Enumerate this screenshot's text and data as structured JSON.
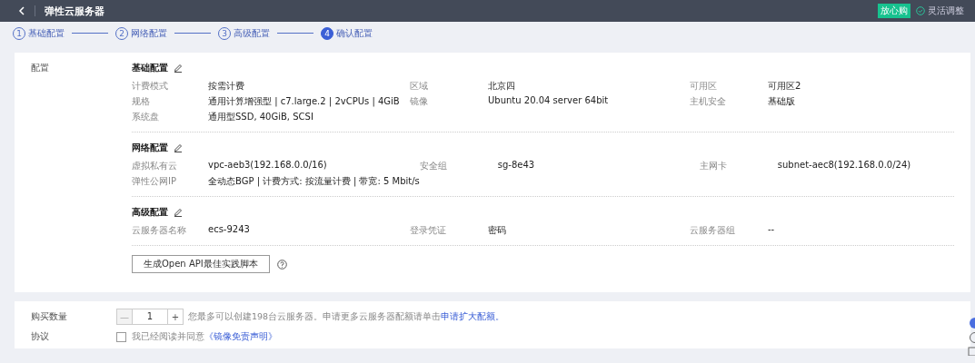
{
  "header": {
    "title": "弹性云服务器",
    "badge": "放心购",
    "adjust": "灵活调整"
  },
  "steps": [
    {
      "number": "1",
      "label": "基础配置",
      "selected": false
    },
    {
      "number": "2",
      "label": "网络配置",
      "selected": false
    },
    {
      "number": "3",
      "label": "高级配置",
      "selected": false
    },
    {
      "number": "4",
      "label": "确认配置",
      "selected": true
    }
  ],
  "config": {
    "label": "配置",
    "sections": [
      {
        "title": "基础配置",
        "fields": [
          {
            "label": "计费模式",
            "value": "按需计费"
          },
          {
            "label": "区域",
            "value": "北京四"
          },
          {
            "label": "可用区",
            "value": "可用区2"
          },
          {
            "label": "规格",
            "value": "通用计算增强型 | c7.large.2 | 2vCPUs | 4GiB"
          },
          {
            "label": "镜像",
            "value": "Ubuntu 20.04 server 64bit"
          },
          {
            "label": "主机安全",
            "value": "基础版"
          },
          {
            "label": "系统盘",
            "value": "通用型SSD, 40GiB, SCSI"
          }
        ]
      },
      {
        "title": "网络配置",
        "fields": [
          {
            "label": "虚拟私有云",
            "value": "vpc-aeb3(192.168.0.0/16)"
          },
          {
            "label": "安全组",
            "value": "sg-8e43"
          },
          {
            "label": "主网卡",
            "value": "subnet-aec8(192.168.0.0/24)"
          },
          {
            "label": "弹性公网IP",
            "value": "全动态BGP | 计费方式: 按流量计费 | 带宽: 5 Mbit/s"
          }
        ]
      },
      {
        "title": "高级配置",
        "fields": [
          {
            "label": "云服务器名称",
            "value": "ecs-9243"
          },
          {
            "label": "登录凭证",
            "value": "密码"
          },
          {
            "label": "云服务器组",
            "value": "--"
          }
        ]
      }
    ],
    "api_button": "生成Open API最佳实践脚本"
  },
  "purchase": {
    "label": "购买数量",
    "minus": "—",
    "quantity": "1",
    "plus": "+",
    "note": "您最多可以创建198台云服务器。申请更多云服务器配额请单击",
    "link": "申请扩大配额。"
  },
  "agreement": {
    "label": "协议",
    "checked": false,
    "text": "我已经阅读并同意",
    "link": "《镜像免责声明》"
  }
}
